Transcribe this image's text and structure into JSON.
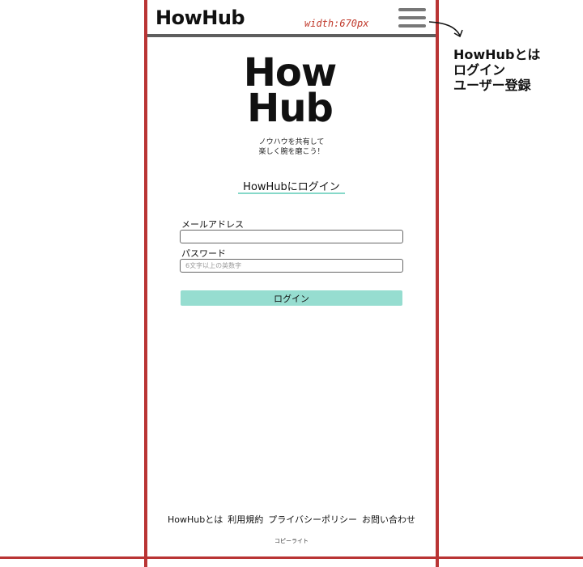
{
  "header": {
    "logo": "HowHub",
    "width_note": "width:670px",
    "menu_icon": "hamburger-icon"
  },
  "side_menu": {
    "items": [
      "HowHubとは",
      "ログイン",
      "ユーザー登録"
    ]
  },
  "hero": {
    "logo_line1": "How",
    "logo_line2": "Hub",
    "tagline_line1": "ノウハウを共有して",
    "tagline_line2": "楽しく腕を磨こう！"
  },
  "login": {
    "title": "HowHubにログイン",
    "email_label": "メールアドレス",
    "email_value": "",
    "password_label": "パスワード",
    "password_placeholder": "6文字以上の英数字",
    "submit_label": "ログイン"
  },
  "footer": {
    "links": [
      "HowHubとは",
      "利用規約",
      "プライバシーポリシー",
      "お問い合わせ"
    ],
    "copyright": "コピーライト"
  },
  "colors": {
    "guide": "#b93434",
    "accent": "#96ddd0",
    "header_line": "#5e5e5e"
  }
}
